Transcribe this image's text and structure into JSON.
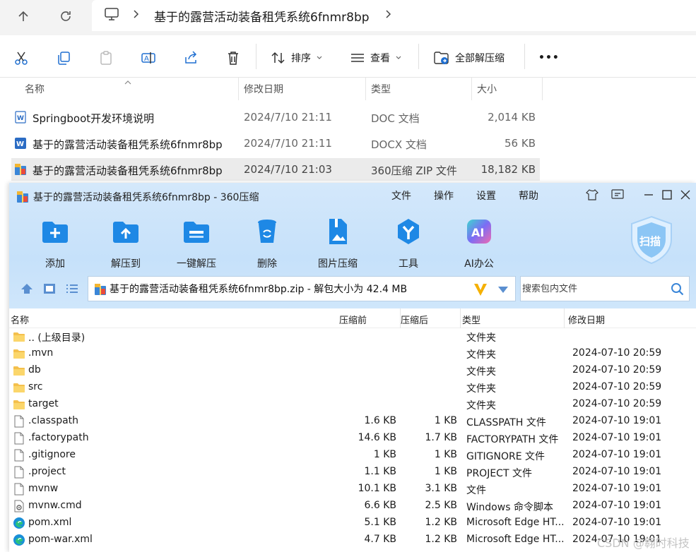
{
  "explorer": {
    "breadcrumb": "基于的露营活动装备租凭系统6fnmr8bp",
    "toolbar": {
      "sort_label": "排序",
      "view_label": "查看",
      "extract_all_label": "全部解压缩",
      "more_label": "•••"
    },
    "columns": {
      "name": "名称",
      "modified": "修改日期",
      "type": "类型",
      "size": "大小"
    },
    "files": [
      {
        "name": "Springboot开发环境说明",
        "modified": "2024/7/10 21:11",
        "type": "DOC 文档",
        "size": "2,014 KB",
        "icon": "word-doc-icon"
      },
      {
        "name": "基于的露营活动装备租凭系统6fnmr8bp",
        "modified": "2024/7/10 21:11",
        "type": "DOCX 文档",
        "size": "56 KB",
        "icon": "word-docx-icon"
      },
      {
        "name": "基于的露营活动装备租凭系统6fnmr8bp",
        "modified": "2024/7/10 21:03",
        "type": "360压缩 ZIP 文件",
        "size": "18,182 KB",
        "icon": "zip-archive-icon"
      }
    ]
  },
  "zip": {
    "title": "基于的露营活动装备租凭系统6fnmr8bp - 360压缩",
    "menu": [
      "文件",
      "操作",
      "设置",
      "帮助"
    ],
    "tools": [
      {
        "label": "添加",
        "icon": "add-icon"
      },
      {
        "label": "解压到",
        "icon": "extract-to-icon"
      },
      {
        "label": "一键解压",
        "icon": "one-click-extract-icon"
      },
      {
        "label": "删除",
        "icon": "delete-icon"
      },
      {
        "label": "图片压缩",
        "icon": "image-compress-icon"
      },
      {
        "label": "工具",
        "icon": "tools-icon"
      },
      {
        "label": "AI办公",
        "icon": "ai-office-icon"
      }
    ],
    "scan_label": "扫描",
    "path": "基于的露营活动装备租凭系统6fnmr8bp.zip - 解包大小为 42.4 MB",
    "search_placeholder": "搜索包内文件",
    "columns": {
      "name": "名称",
      "packed": "压缩前",
      "unpacked": "压缩后",
      "type": "类型",
      "modified": "修改日期"
    },
    "rows": [
      {
        "name": ".. (上级目录)",
        "size": "",
        "packed": "",
        "type": "文件夹",
        "modified": "",
        "icon": "folder-icon"
      },
      {
        "name": ".mvn",
        "size": "",
        "packed": "",
        "type": "文件夹",
        "modified": "2024-07-10 20:59",
        "icon": "folder-icon"
      },
      {
        "name": "db",
        "size": "",
        "packed": "",
        "type": "文件夹",
        "modified": "2024-07-10 20:59",
        "icon": "folder-icon"
      },
      {
        "name": "src",
        "size": "",
        "packed": "",
        "type": "文件夹",
        "modified": "2024-07-10 20:59",
        "icon": "folder-icon"
      },
      {
        "name": "target",
        "size": "",
        "packed": "",
        "type": "文件夹",
        "modified": "2024-07-10 20:59",
        "icon": "folder-icon"
      },
      {
        "name": ".classpath",
        "size": "1.6 KB",
        "packed": "1 KB",
        "type": "CLASSPATH 文件",
        "modified": "2024-07-10 19:01",
        "icon": "file-icon"
      },
      {
        "name": ".factorypath",
        "size": "14.6 KB",
        "packed": "1.7 KB",
        "type": "FACTORYPATH 文件",
        "modified": "2024-07-10 19:01",
        "icon": "file-icon"
      },
      {
        "name": ".gitignore",
        "size": "1 KB",
        "packed": "1 KB",
        "type": "GITIGNORE 文件",
        "modified": "2024-07-10 19:01",
        "icon": "file-icon"
      },
      {
        "name": ".project",
        "size": "1.1 KB",
        "packed": "1 KB",
        "type": "PROJECT 文件",
        "modified": "2024-07-10 19:01",
        "icon": "file-icon"
      },
      {
        "name": "mvnw",
        "size": "10.1 KB",
        "packed": "3.1 KB",
        "type": "文件",
        "modified": "2024-07-10 19:01",
        "icon": "file-icon"
      },
      {
        "name": "mvnw.cmd",
        "size": "6.6 KB",
        "packed": "2.5 KB",
        "type": "Windows 命令脚本",
        "modified": "2024-07-10 19:01",
        "icon": "cmd-script-icon"
      },
      {
        "name": "pom.xml",
        "size": "5.1 KB",
        "packed": "1.2 KB",
        "type": "Microsoft Edge HT...",
        "modified": "2024-07-10 19:01",
        "icon": "edge-icon"
      },
      {
        "name": "pom-war.xml",
        "size": "4.7 KB",
        "packed": "1.2 KB",
        "type": "Microsoft Edge HT...",
        "modified": "2024-07-10 19:01",
        "icon": "edge-icon"
      }
    ]
  },
  "watermark": "CSDN @翱时科技"
}
